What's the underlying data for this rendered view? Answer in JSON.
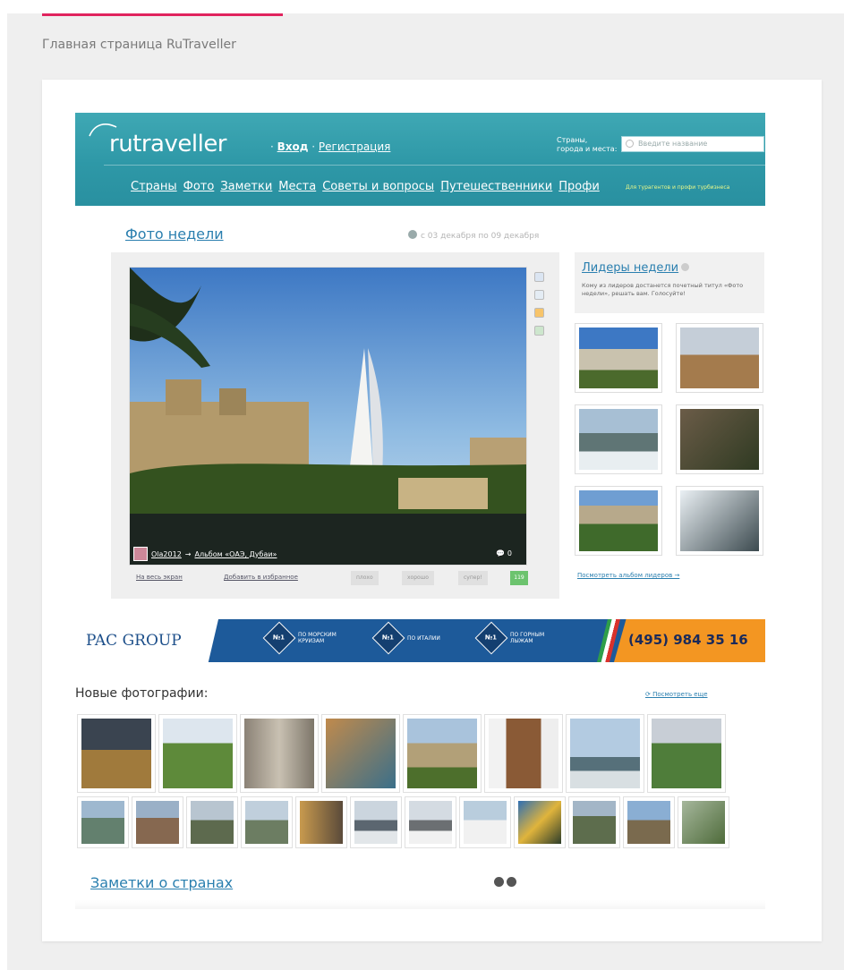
{
  "caption": "Главная страница RuTraveller",
  "colors": {
    "accent": "#e0245e",
    "header": "#2e98a7",
    "link": "#2a7faf",
    "banner": "#1d5a9a",
    "phone_bg": "#f39622"
  },
  "header": {
    "logo": "rutraveller",
    "login": "Вход",
    "register": "Регистрация",
    "places_label_1": "Страны,",
    "places_label_2": "города и места:",
    "search_placeholder": "Введите название",
    "nav": [
      "Страны",
      "Фото",
      "Заметки",
      "Места",
      "Советы и вопросы",
      "Путешественники",
      "Профи"
    ],
    "nav_note": "Для турагентов и профи турбизнеса"
  },
  "week": {
    "title": "Фото недели",
    "dates": "с 03 декабря по 09 декабря",
    "author": "Ola2012",
    "album": "Альбом «ОАЭ, Дубаи»",
    "comments": "0",
    "fullscreen": "На весь экран",
    "favorite": "Добавить в избранное",
    "rate_bad": "плохо",
    "rate_good": "хорошо",
    "rate_super": "супер!",
    "rate_count": "119"
  },
  "leaders": {
    "title": "Лидеры недели",
    "desc": "Кому из лидеров достанется почетный титул «Фото недели», решать вам. Голосуйте!",
    "see_album": "Посмотреть альбом лидеров →"
  },
  "banner": {
    "logo": "PAC GROUP",
    "badges": [
      {
        "num": "№1",
        "text": "ПО МОРСКИМ КРУИЗАМ"
      },
      {
        "num": "№1",
        "text": "ПО ИТАЛИИ"
      },
      {
        "num": "№1",
        "text": "ПО ГОРНЫМ ЛЫЖАМ"
      }
    ],
    "phone": "(495) 984 35 16"
  },
  "new_photos": {
    "title": "Новые фотографии:",
    "see_more": "Посмотреть еще"
  },
  "notes": {
    "title": "Заметки о странах"
  }
}
